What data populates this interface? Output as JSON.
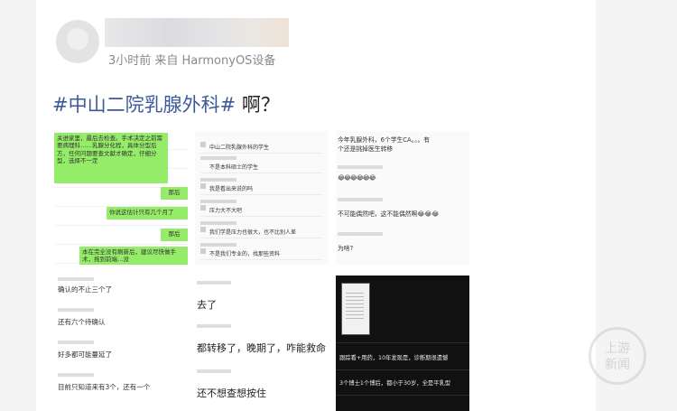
{
  "post": {
    "meta": "3小时前 来自 HarmonyOS设备",
    "title_hashtag": "#中山二院乳腺外科#",
    "title_rest": " 啊？"
  },
  "tiles": {
    "t1": {
      "bubble1": "关进家里，最后去检查。手术决定之前需要病理科……乳腺分化程，具体分型后方，任何问题要查文献才确定，仔细分型，选择不一定",
      "bubble2": "那后",
      "bubble3": "你说这估计只有几个月了",
      "bubble4": "那后",
      "bubble5": "本在完全没有刷新后，建议尽快做手术，拖到前端…没"
    },
    "t2": {
      "rows": [
        "中山二院乳腺外科的学生",
        "不是本科硕士的学生",
        "我是看出来说的吗",
        "压力大不大吧",
        "我们学是压力也很大，也不比别人差",
        "不是我们专业的，找那些资料"
      ]
    },
    "t3": {
      "line1": "今年乳腺外科，6个学生CA。。。有",
      "line2": "个还是挑掉医生转移",
      "emoji1": "😂😂😂😂😂😂",
      "line3": "不可能偶然吧，这不能偶然啊😂😂😂",
      "line4": "为啥?"
    },
    "t4": {
      "rows": [
        "确认的不止三个了",
        "还有六个待确认",
        "好多都可能蔓延了",
        "目前只知道来有3个，还有一个"
      ]
    },
    "t5": {
      "rows": [
        "去了",
        "都转移了，晚期了，咋能救命",
        "还不想查想按住"
      ]
    },
    "t6": {
      "line1": "跟踪看+用药，10年发现是，诊断期很遗憾",
      "line2": "3个博士1个博后，都小于30岁，全是平乳型"
    }
  },
  "watermark": {
    "line1": "上游",
    "line2": "新闻"
  }
}
